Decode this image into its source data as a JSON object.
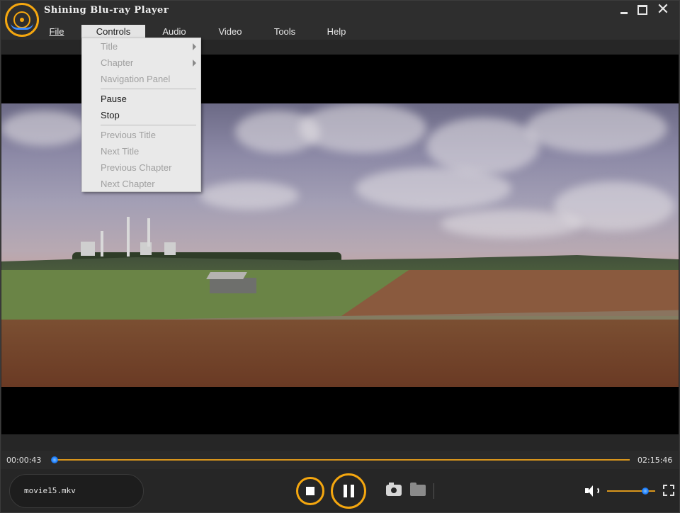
{
  "window": {
    "title": "Shining Blu-ray Player",
    "logo_icon": "bluray-disc-logo-icon",
    "close_glyph": "✕"
  },
  "menu": {
    "file": "File",
    "controls": "Controls",
    "audio": "Audio",
    "video": "Video",
    "tools": "Tools",
    "help": "Help"
  },
  "controls_menu": {
    "items": [
      {
        "label": "Title",
        "enabled": false,
        "submenu": true
      },
      {
        "label": "Chapter",
        "enabled": false,
        "submenu": true
      },
      {
        "label": "Navigation Panel",
        "enabled": false,
        "submenu": false
      },
      {
        "label": "Pause",
        "enabled": true,
        "submenu": false
      },
      {
        "label": "Stop",
        "enabled": true,
        "submenu": false
      },
      {
        "label": "Previous Title",
        "enabled": false,
        "submenu": false
      },
      {
        "label": "Next Title",
        "enabled": false,
        "submenu": false
      },
      {
        "label": "Previous Chapter",
        "enabled": false,
        "submenu": false
      },
      {
        "label": "Next Chapter",
        "enabled": false,
        "submenu": false
      }
    ]
  },
  "playback": {
    "current_time": "00:00:43",
    "total_time": "02:15:46",
    "progress_fraction": 0.0053,
    "volume_fraction": 0.8
  },
  "file": {
    "name": "movie15.mkv"
  },
  "colors": {
    "accent": "#f5a70f",
    "thumb": "#1d7fff",
    "track": "#d9961c"
  }
}
